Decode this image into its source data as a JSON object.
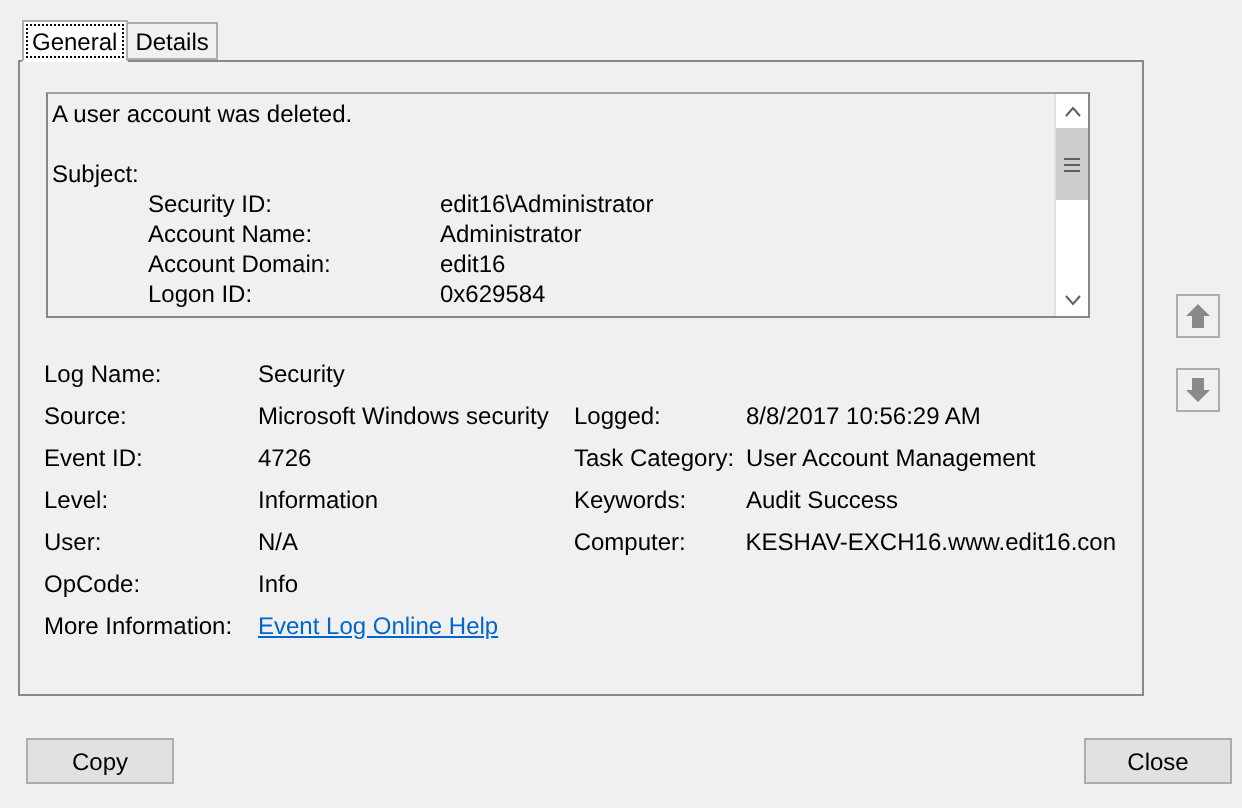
{
  "tabs": [
    {
      "label": "General",
      "selected": true
    },
    {
      "label": "Details",
      "selected": false
    }
  ],
  "description": {
    "summary": "A user account was deleted.",
    "section": "Subject:",
    "fields": [
      {
        "label": "Security ID:",
        "value": "edit16\\Administrator"
      },
      {
        "label": "Account Name:",
        "value": "Administrator"
      },
      {
        "label": "Account Domain:",
        "value": "edit16"
      },
      {
        "label": "Logon ID:",
        "value": "0x629584"
      }
    ]
  },
  "details": [
    {
      "left": {
        "label": "Log Name:",
        "value": "Security",
        "kind": "text"
      }
    },
    {
      "left": {
        "label": "Source:",
        "value": "Microsoft Windows security",
        "kind": "text"
      },
      "right": {
        "label": "Logged:",
        "value": "8/8/2017 10:56:29 AM"
      }
    },
    {
      "left": {
        "label": "Event ID:",
        "value": "4726",
        "kind": "text"
      },
      "right": {
        "label": "Task Category:",
        "value": "User Account Management"
      }
    },
    {
      "left": {
        "label": "Level:",
        "value": "Information",
        "kind": "text"
      },
      "right": {
        "label": "Keywords:",
        "value": "Audit Success"
      }
    },
    {
      "left": {
        "label": "User:",
        "value": "N/A",
        "kind": "text"
      },
      "right": {
        "label": "Computer:",
        "value": "KESHAV-EXCH16.www.edit16.con"
      }
    },
    {
      "left": {
        "label": "OpCode:",
        "value": "Info",
        "kind": "text"
      }
    },
    {
      "left": {
        "label": "More Information:",
        "value": "Event Log Online Help",
        "kind": "link"
      }
    }
  ],
  "buttons": [
    "Copy",
    "Close"
  ]
}
